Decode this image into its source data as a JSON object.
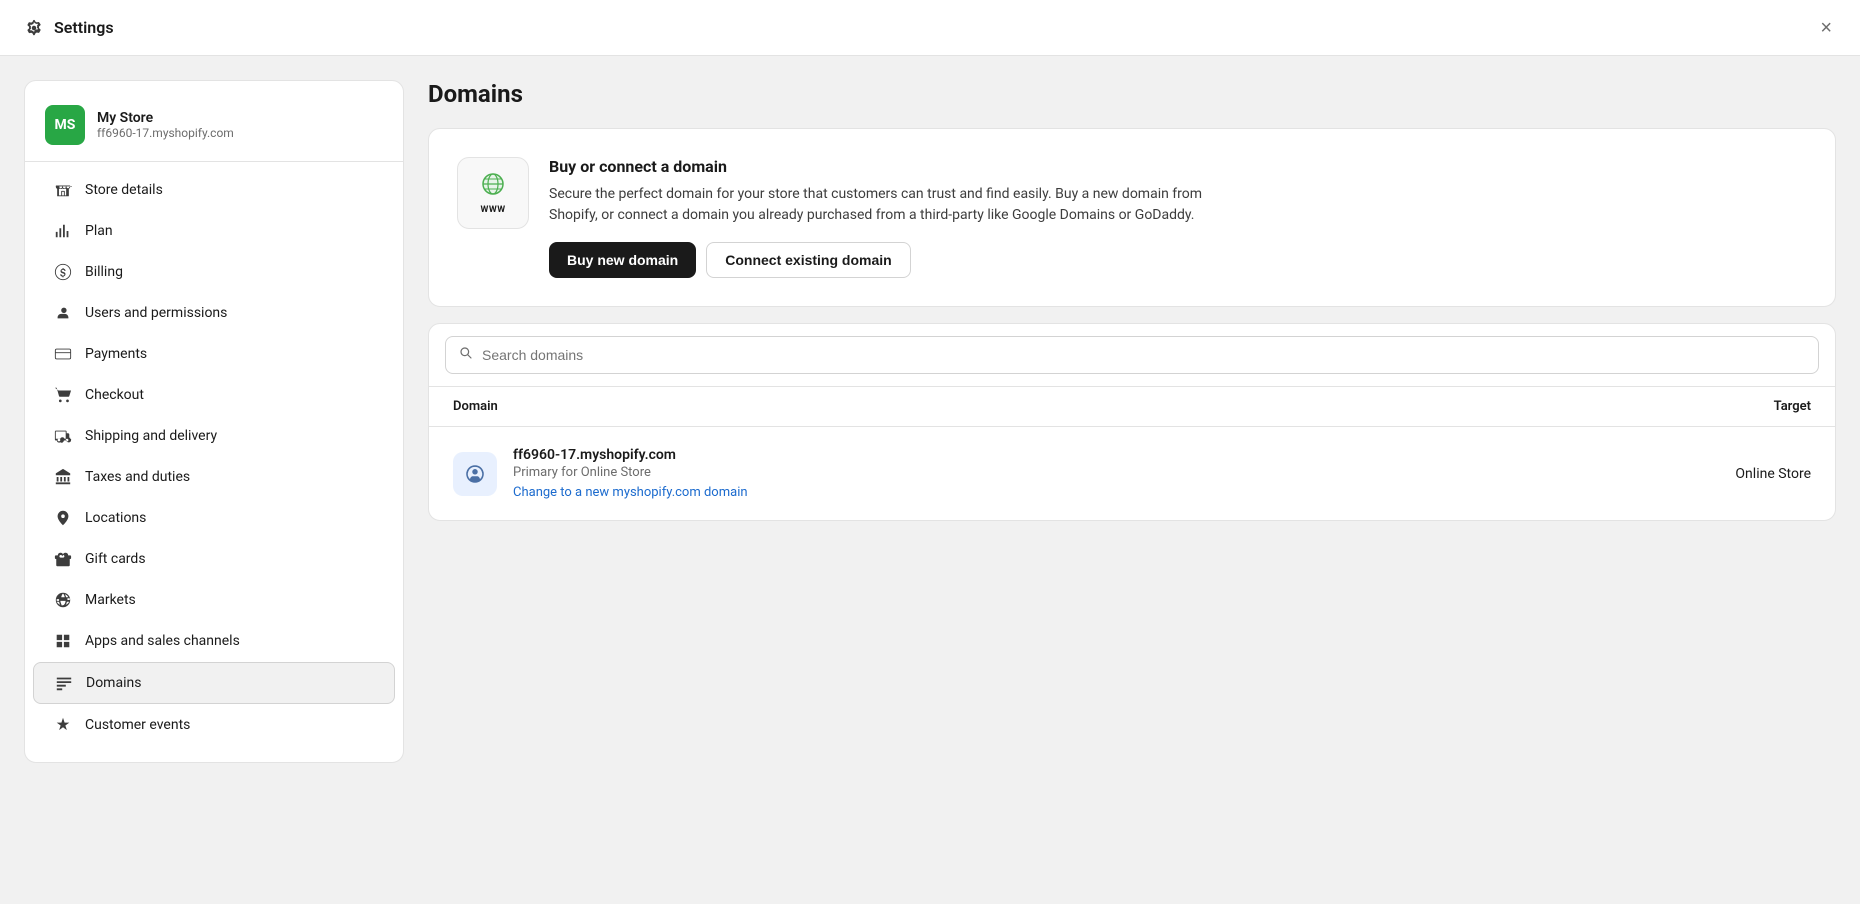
{
  "topbar": {
    "title": "Settings",
    "close_label": "×"
  },
  "sidebar": {
    "store": {
      "avatar": "MS",
      "name": "My Store",
      "url": "ff6960-17.myshopify.com"
    },
    "nav_items": [
      {
        "id": "store-details",
        "label": "Store details",
        "icon": "🏪"
      },
      {
        "id": "plan",
        "label": "Plan",
        "icon": "📊"
      },
      {
        "id": "billing",
        "label": "Billing",
        "icon": "🧾"
      },
      {
        "id": "users-permissions",
        "label": "Users and permissions",
        "icon": "👤"
      },
      {
        "id": "payments",
        "label": "Payments",
        "icon": "💳"
      },
      {
        "id": "checkout",
        "label": "Checkout",
        "icon": "🛒"
      },
      {
        "id": "shipping-delivery",
        "label": "Shipping and delivery",
        "icon": "🚚"
      },
      {
        "id": "taxes-duties",
        "label": "Taxes and duties",
        "icon": "📋"
      },
      {
        "id": "locations",
        "label": "Locations",
        "icon": "📍"
      },
      {
        "id": "gift-cards",
        "label": "Gift cards",
        "icon": "🎁"
      },
      {
        "id": "markets",
        "label": "Markets",
        "icon": "🌐"
      },
      {
        "id": "apps-sales-channels",
        "label": "Apps and sales channels",
        "icon": "⊞"
      },
      {
        "id": "domains",
        "label": "Domains",
        "icon": "▤",
        "active": true
      },
      {
        "id": "customer-events",
        "label": "Customer events",
        "icon": "✦"
      }
    ]
  },
  "main": {
    "page_title": "Domains",
    "promo_card": {
      "title": "Buy or connect a domain",
      "description": "Secure the perfect domain for your store that customers can trust and find easily. Buy a new domain from Shopify, or connect a domain you already purchased from a third-party like Google Domains or GoDaddy.",
      "btn_primary": "Buy new domain",
      "btn_secondary": "Connect existing domain",
      "icon_label": "WWW"
    },
    "search": {
      "placeholder": "Search domains"
    },
    "table": {
      "col_domain": "Domain",
      "col_target": "Target",
      "rows": [
        {
          "domain": "ff6960-17.myshopify.com",
          "sub_label": "Primary for Online Store",
          "link_label": "Change to a new myshopify.com domain",
          "target": "Online Store"
        }
      ]
    }
  }
}
